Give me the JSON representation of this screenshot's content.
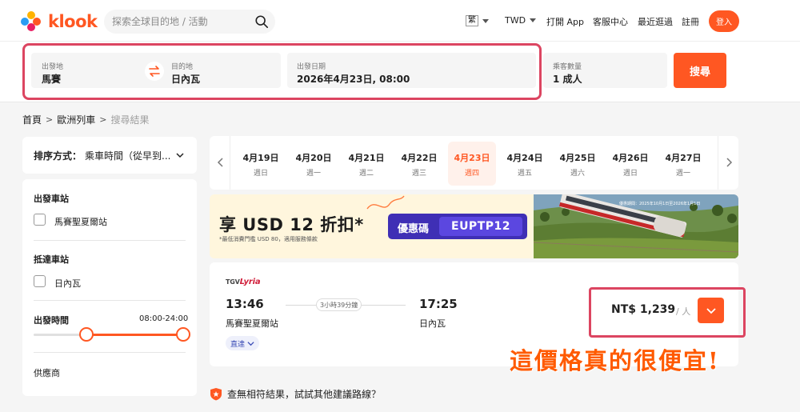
{
  "brand": {
    "name": "klook"
  },
  "header": {
    "search_placeholder": "探索全球目的地 / 活動",
    "lang": "繁",
    "currency": "TWD",
    "nav": [
      "打開 App",
      "客服中心",
      "最近逛過",
      "註冊"
    ],
    "login": "登入"
  },
  "search_form": {
    "from_label": "出發地",
    "from_value": "馬賽",
    "to_label": "目的地",
    "to_value": "日內瓦",
    "date_label": "出發日期",
    "date_value": "2026年4月23日, 08:00",
    "pax_label": "乘客數量",
    "pax_value": "1 成人",
    "submit": "搜尋"
  },
  "breadcrumb": [
    "首頁",
    "歐洲列車",
    "搜尋結果"
  ],
  "sort": {
    "label": "排序方式：",
    "value": "乘車時間（從早到..."
  },
  "filters": {
    "depart_station_title": "出發車站",
    "depart_station_option": "馬賽聖夏爾站",
    "arrive_station_title": "抵達車站",
    "arrive_station_option": "日內瓦",
    "time_title": "出發時間",
    "time_range": "08:00-24:00",
    "time_range_start_fraction": 0.333,
    "time_range_end_fraction": 1.0,
    "supplier_title": "供應商"
  },
  "dates": [
    {
      "d": "4月19日",
      "w": "週日"
    },
    {
      "d": "4月20日",
      "w": "週一"
    },
    {
      "d": "4月21日",
      "w": "週二"
    },
    {
      "d": "4月22日",
      "w": "週三"
    },
    {
      "d": "4月23日",
      "w": "週四",
      "active": true
    },
    {
      "d": "4月24日",
      "w": "週五"
    },
    {
      "d": "4月25日",
      "w": "週六"
    },
    {
      "d": "4月26日",
      "w": "週日"
    },
    {
      "d": "4月27日",
      "w": "週一"
    }
  ],
  "promo": {
    "title": "享 USD 12 折扣*",
    "subtitle": "*最低消費門檻 USD 80，適用服務條款",
    "code_label": "優惠碼",
    "code": "EUPTP12",
    "period": "優惠期間：2025年10月1日至2026年1月1日"
  },
  "result": {
    "operator_prefix": "TGV",
    "operator_brand": "Lyria",
    "depart_time": "13:46",
    "depart_station": "馬賽聖夏爾站",
    "duration": "3小時39分鐘",
    "arrive_time": "17:25",
    "arrive_station": "日內瓦",
    "tag": "直達",
    "price": "NT$ 1,239",
    "per": "/ 人"
  },
  "no_match_note": "查無相符結果，試試其他建議路線？",
  "annotation": "這價格真的很便宜!",
  "colors": {
    "accent": "#ff5722",
    "highlight": "#dc4561",
    "coupon": "#3f2fb5"
  }
}
